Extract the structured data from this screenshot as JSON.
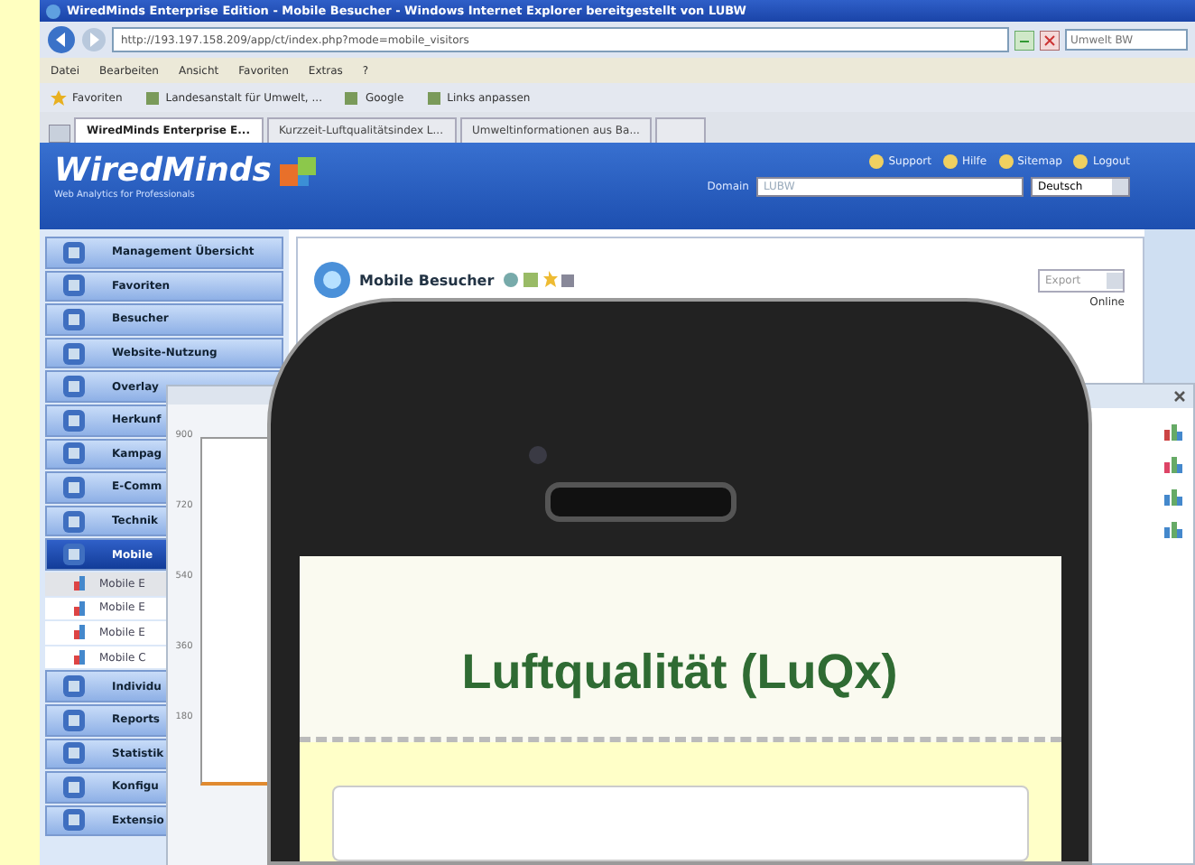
{
  "window": {
    "title": "WiredMinds Enterprise Edition - Mobile Besucher - Windows Internet Explorer bereitgestellt von LUBW"
  },
  "address_bar": {
    "url": "http://193.197.158.209/app/ct/index.php?mode=mobile_visitors",
    "search_placeholder": "Umwelt BW"
  },
  "menu_bar": [
    "Datei",
    "Bearbeiten",
    "Ansicht",
    "Favoriten",
    "Extras",
    "?"
  ],
  "favorites_bar": [
    "Favoriten",
    "Landesanstalt für Umwelt, ...",
    "Google",
    "Links anpassen"
  ],
  "tabs": [
    {
      "label": "WiredMinds Enterprise E...",
      "selected": true
    },
    {
      "label": "Kurzzeit-Luftqualitätsindex L...",
      "selected": false
    },
    {
      "label": "Umweltinformationen aus Ba...",
      "selected": false
    }
  ],
  "header": {
    "logo": "WiredMinds",
    "tagline": "Web Analytics for Professionals",
    "links": [
      "Support",
      "Hilfe",
      "Sitemap",
      "Logout"
    ],
    "domain_label": "Domain",
    "domain_value": "LUBW",
    "language": "Deutsch"
  },
  "sidebar": {
    "items": [
      {
        "label": "Management Übersicht",
        "kind": "section",
        "selected": false
      },
      {
        "label": "Favoriten",
        "kind": "section",
        "selected": false
      },
      {
        "label": "Besucher",
        "kind": "section",
        "selected": false
      },
      {
        "label": "Website-Nutzung",
        "kind": "section",
        "selected": false
      },
      {
        "label": "Overlay",
        "kind": "section",
        "selected": false
      },
      {
        "label": "Herkunf",
        "kind": "section",
        "selected": false
      },
      {
        "label": "Kampag",
        "kind": "section",
        "selected": false
      },
      {
        "label": "E-Comm",
        "kind": "section",
        "selected": false
      },
      {
        "label": "Technik",
        "kind": "section",
        "selected": false
      },
      {
        "label": "Mobile",
        "kind": "section",
        "selected": true
      },
      {
        "label": "Mobile E",
        "kind": "sub",
        "selected": true
      },
      {
        "label": "Mobile E",
        "kind": "sub",
        "selected": false
      },
      {
        "label": "Mobile E",
        "kind": "sub",
        "selected": false
      },
      {
        "label": "Mobile C",
        "kind": "sub",
        "selected": false
      },
      {
        "label": "Individu",
        "kind": "section",
        "selected": false
      },
      {
        "label": "Reports",
        "kind": "section",
        "selected": false
      },
      {
        "label": "Statistik",
        "kind": "section",
        "selected": false
      },
      {
        "label": "Konfigu",
        "kind": "section",
        "selected": false
      },
      {
        "label": "Extensio",
        "kind": "section",
        "selected": false
      }
    ]
  },
  "content": {
    "title": "Mobile Besucher",
    "export": "Export",
    "online": "Online"
  },
  "chart_popup": {
    "axis_labels": [
      "900",
      "720",
      "540",
      "360",
      "180"
    ]
  },
  "phone": {
    "title": "Luftqualität (LuQx)"
  }
}
